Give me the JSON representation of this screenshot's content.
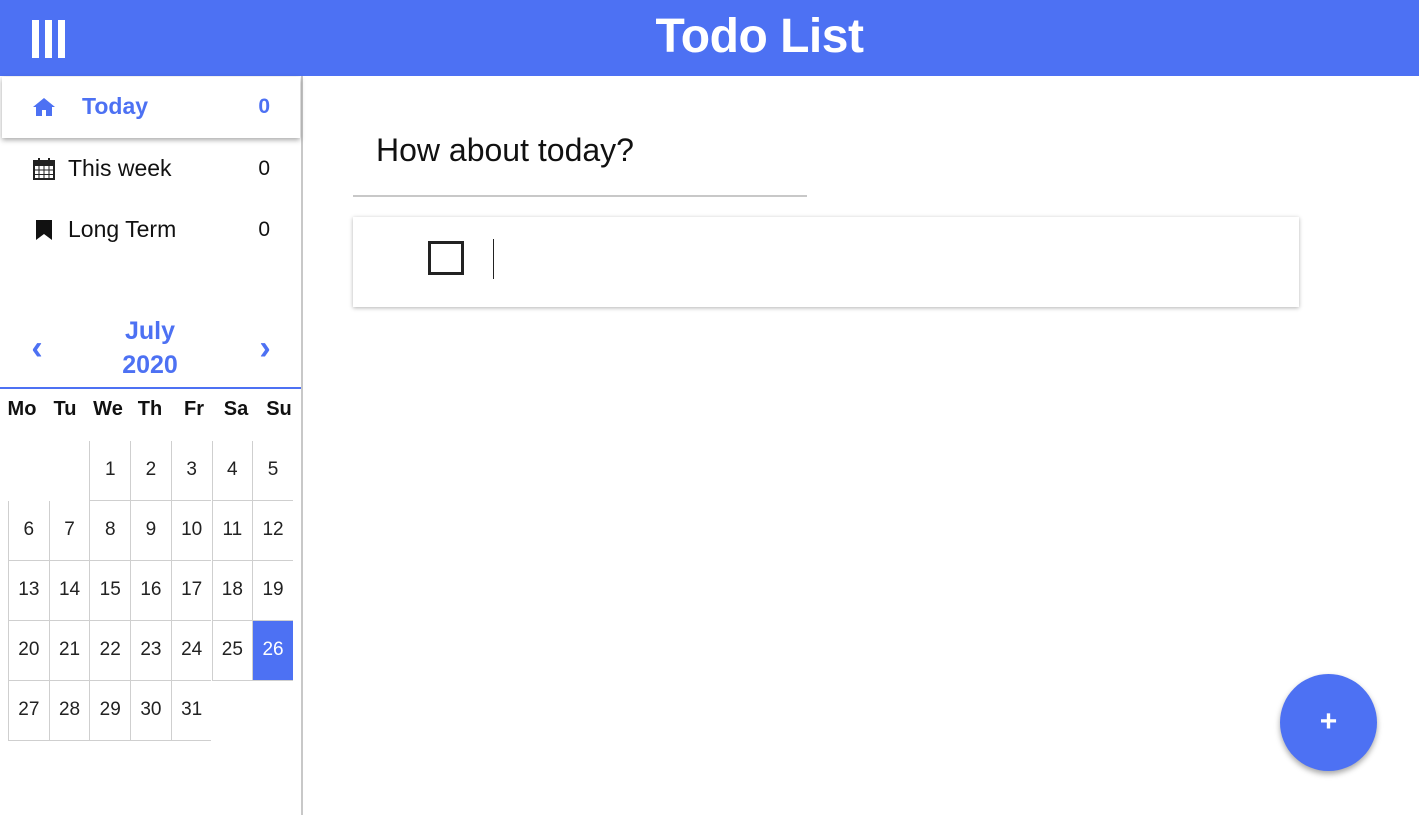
{
  "header": {
    "title": "Todo List",
    "menu_icon": "menu-bars-icon",
    "color": "#4d71f3"
  },
  "sidebar": {
    "items": [
      {
        "label": "Today",
        "count": "0",
        "icon": "home-icon",
        "active": true
      },
      {
        "label": "This week",
        "count": "0",
        "icon": "calendar-icon",
        "active": false
      },
      {
        "label": "Long Term",
        "count": "0",
        "icon": "bookmark-icon",
        "active": false
      }
    ]
  },
  "calendar": {
    "prev": "‹",
    "next": "›",
    "month": "July",
    "year": "2020",
    "weekdays": [
      "Mo",
      "Tu",
      "We",
      "Th",
      "Fr",
      "Sa",
      "Su"
    ],
    "days": [
      "1",
      "2",
      "3",
      "4",
      "5",
      "6",
      "7",
      "8",
      "9",
      "10",
      "11",
      "12",
      "13",
      "14",
      "15",
      "16",
      "17",
      "18",
      "19",
      "20",
      "21",
      "22",
      "23",
      "24",
      "25",
      "26",
      "27",
      "28",
      "29",
      "30",
      "31"
    ],
    "selected_day": "26",
    "first_weekday_index": 2
  },
  "main": {
    "heading": "How about today?",
    "todo_placeholder": "",
    "todo_value": ""
  },
  "fab": {
    "label": "+"
  }
}
